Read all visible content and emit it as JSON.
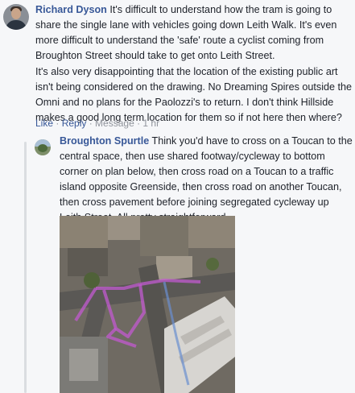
{
  "comments": [
    {
      "author": "Richard Dyson",
      "text_p1": " It's difficult to understand how the tram is going to share the single lane with vehicles going down Leith Walk. It's even more difficult to understand the 'safe' route a cyclist coming from Broughton Street should take to get onto Leith Street.",
      "text_p2": "It's also very disappointing that the location of the existing public art isn't being considered on the drawing. No Dreaming Spires outside the Omni and no plans for the Paolozzi's to return. I don't think Hillside makes a good long term location for them so if not here then where?",
      "actions": {
        "like": "Like",
        "reply": "Reply",
        "message": "Message",
        "time": "1 hr",
        "sep": " · "
      }
    }
  ],
  "reply": {
    "author": "Broughton Spurtle",
    "text": " Think you'd have to cross on a Toucan to the central space, then use shared footway/cycleway to bottom corner on plan below, then cross road on a Toucan to a traffic island opposite Greenside, then cross road on another Toucan, then cross pavement before joining segregated cycleway up Leith Street. All pretty straightforward."
  },
  "colors": {
    "background": "#f6f7f9",
    "link": "#385898",
    "meta": "#90949c",
    "text": "#1d2129",
    "route_overlay": "#c25ad0"
  },
  "icons": {
    "richard_avatar": "profile-photo",
    "broughton_avatar": "profile-photo",
    "attachment": "aerial-photo"
  }
}
